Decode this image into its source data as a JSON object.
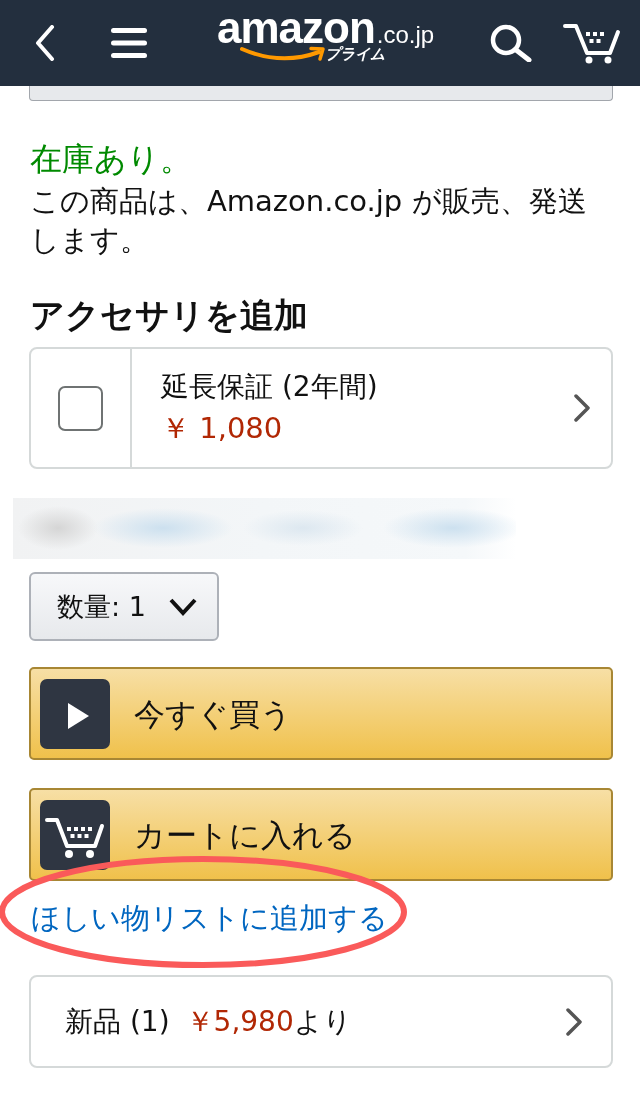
{
  "header": {
    "logo": {
      "wordmark": "amazon",
      "domain": ".co.jp",
      "subtitle": "プライム"
    }
  },
  "availability": {
    "status": "在庫あり。",
    "note": "この商品は、Amazon.co.jp が販売、発送します。"
  },
  "accessories": {
    "heading": "アクセサリを追加",
    "items": [
      {
        "label": "延長保証 (2年間)",
        "price": "￥ 1,080",
        "checked": false
      }
    ]
  },
  "quantity": {
    "text": "数量: 1"
  },
  "actions": [
    {
      "kind": "buy_now",
      "label": "今すぐ買う"
    },
    {
      "kind": "add_to_cart",
      "label": "カートに入れる"
    }
  ],
  "wishlist_link": {
    "label": "ほしい物リストに追加する",
    "highlighted": true
  },
  "offers": {
    "label": "新品 (1)",
    "price": "￥5,980",
    "suffix": "より"
  }
}
